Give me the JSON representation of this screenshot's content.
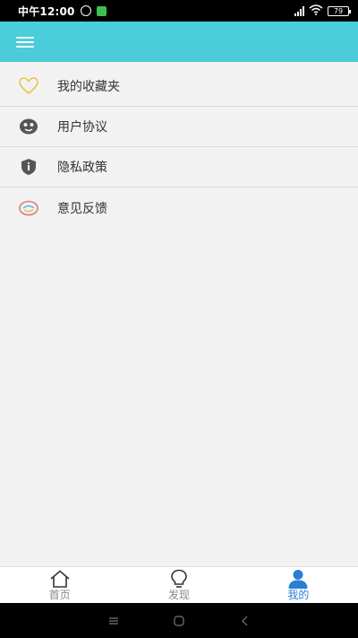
{
  "status_bar": {
    "time": "中午12:00",
    "battery": "79"
  },
  "menu": {
    "items": [
      {
        "label": "我的收藏夹",
        "icon": "heart-icon"
      },
      {
        "label": "用户协议",
        "icon": "agreement-icon"
      },
      {
        "label": "隐私政策",
        "icon": "shield-info-icon"
      },
      {
        "label": "意见反馈",
        "icon": "feedback-icon"
      }
    ]
  },
  "bottom_nav": {
    "items": [
      {
        "label": "首页",
        "icon": "home-icon"
      },
      {
        "label": "发现",
        "icon": "lightbulb-icon"
      },
      {
        "label": "我的",
        "icon": "user-icon"
      }
    ]
  },
  "colors": {
    "header": "#4ccad8",
    "active": "#2a7fd4"
  }
}
